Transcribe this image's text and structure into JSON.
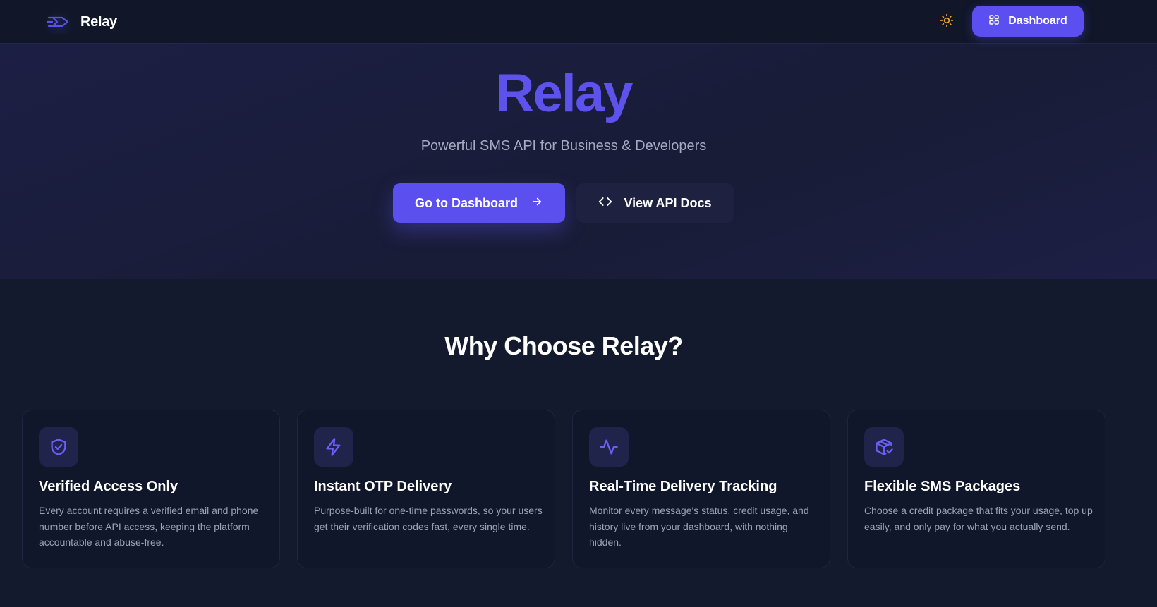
{
  "header": {
    "brand_name": "Relay",
    "logo_icon": "relay-arrow-logo",
    "theme_toggle_icon": "sun-icon",
    "dashboard_button": {
      "label": "Dashboard",
      "icon": "grid-icon"
    }
  },
  "hero": {
    "title": "Relay",
    "subtitle": "Powerful SMS API for Business & Developers",
    "primary_cta": {
      "label": "Go to Dashboard",
      "icon": "arrow-right-icon"
    },
    "secondary_cta": {
      "label": "View API Docs",
      "icon": "code-icon"
    }
  },
  "features": {
    "title": "Why Choose Relay?",
    "cards": [
      {
        "icon": "shield-check-icon",
        "title": "Verified Access Only",
        "description": "Every account requires a verified email and phone number before API access, keeping the platform accountable and abuse-free."
      },
      {
        "icon": "lightning-icon",
        "title": "Instant OTP Delivery",
        "description": "Purpose-built for one-time passwords, so your users get their verification codes fast, every single time."
      },
      {
        "icon": "activity-icon",
        "title": "Real-Time Delivery Tracking",
        "description": "Monitor every message's status, credit usage, and history live from your dashboard, with nothing hidden."
      },
      {
        "icon": "package-check-icon",
        "title": "Flexible SMS Packages",
        "description": "Choose a credit package that fits your usage, top up easily, and only pay for what you actually send."
      }
    ]
  },
  "colors": {
    "accent": "#5b4ff0",
    "hero_title": "#5e52ec",
    "background": "#131a2e",
    "card_bg": "#11172a",
    "sun_icon": "#f5a524",
    "muted_text": "#9aa3b8"
  }
}
